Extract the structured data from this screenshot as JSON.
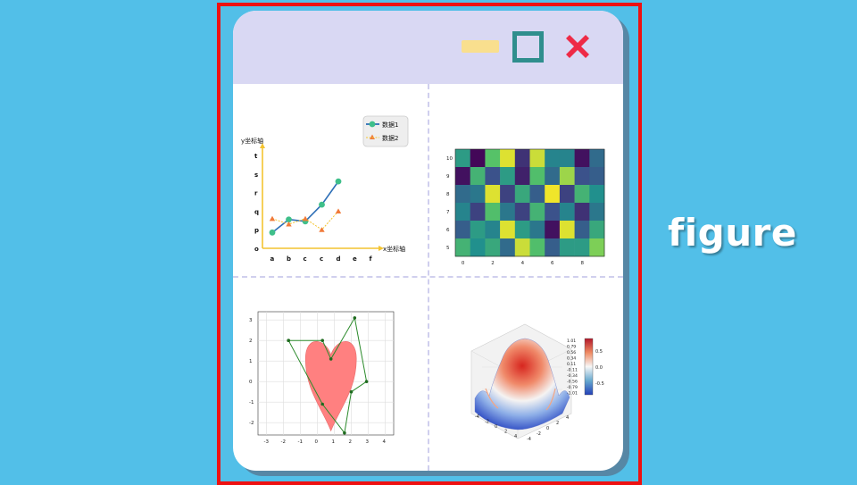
{
  "side_label": "figure",
  "colors": {
    "background": "#52bfe8",
    "highlight_border": "#ee1111",
    "titlebar": "#d9d8f3",
    "minimize": "#f9df8e",
    "maximize": "#2f8e8d",
    "close": "#ee2a46"
  },
  "window": {
    "controls": [
      "minimize-icon",
      "maximize-icon",
      "close-icon"
    ]
  },
  "chart_data": [
    {
      "type": "line",
      "xlabel": "x坐标轴",
      "ylabel": "y坐标轴",
      "categories": [
        "a",
        "b",
        "c",
        "c",
        "d",
        "e",
        "f"
      ],
      "yticks": [
        "o",
        "p",
        "q",
        "r",
        "s",
        "t"
      ],
      "ylim": [
        0,
        5
      ],
      "legend": "top-right",
      "series": [
        {
          "name": "数据1",
          "marker": "circle",
          "color": "#2e6fb7",
          "values": [
            0.85,
            1.55,
            1.45,
            2.35,
            3.6
          ]
        },
        {
          "name": "数据2",
          "marker": "triangle",
          "color": "#f4c430",
          "values": [
            1.6,
            1.3,
            1.6,
            1.0,
            2.0
          ]
        }
      ]
    },
    {
      "type": "heatmap",
      "xticks": [
        "0",
        "2",
        "4",
        "6",
        "8"
      ],
      "yticks": [
        "5",
        "6",
        "7",
        "8",
        "9",
        "10"
      ],
      "columns": 10,
      "rows": 6,
      "values": [
        [
          0.55,
          0.02,
          0.72,
          0.95,
          0.15,
          0.92,
          0.45,
          0.45,
          0.05,
          0.35
        ],
        [
          0.05,
          0.65,
          0.25,
          0.55,
          0.1,
          0.7,
          0.35,
          0.85,
          0.25,
          0.3
        ],
        [
          0.35,
          0.4,
          0.95,
          0.2,
          0.6,
          0.3,
          0.98,
          0.2,
          0.65,
          0.5
        ],
        [
          0.45,
          0.2,
          0.7,
          0.4,
          0.2,
          0.65,
          0.25,
          0.45,
          0.15,
          0.4
        ],
        [
          0.3,
          0.55,
          0.45,
          0.95,
          0.55,
          0.4,
          0.05,
          0.95,
          0.3,
          0.6
        ],
        [
          0.65,
          0.5,
          0.6,
          0.35,
          0.92,
          0.7,
          0.3,
          0.55,
          0.55,
          0.8
        ]
      ]
    },
    {
      "type": "scatter",
      "xlim": [
        -3.5,
        4.5
      ],
      "ylim": [
        -2.6,
        3.4
      ],
      "xticks": [
        "-3",
        "-2",
        "-1",
        "0",
        "1",
        "2",
        "3",
        "4"
      ],
      "yticks": [
        "-2",
        "-1",
        "0",
        "1",
        "2",
        "3"
      ],
      "grid": true,
      "polygon": [
        [
          -1.7,
          2.0
        ],
        [
          0.3,
          2.0
        ],
        [
          0.8,
          1.1
        ],
        [
          2.2,
          3.1
        ],
        [
          2.9,
          0.0
        ],
        [
          2.0,
          -0.5
        ],
        [
          1.6,
          -2.5
        ],
        [
          0.3,
          -1.1
        ],
        [
          -1.7,
          2.0
        ]
      ],
      "heart_color": "#ff8080",
      "polygon_color": "#2a8a2a"
    },
    {
      "type": "surface",
      "colorbar_ticks": [
        "1.01",
        "0.79",
        "0.56",
        "0.34",
        "0.11",
        "-0.11",
        "-0.34",
        "-0.56",
        "-0.79",
        "-1.01"
      ],
      "colorbar_axis": [
        "0.5",
        "0.0",
        "-0.5"
      ],
      "xticks": [
        "-4",
        "-2",
        "0",
        "2",
        "4"
      ],
      "yticks": [
        "-4",
        "-2",
        "0",
        "2",
        "4"
      ]
    }
  ]
}
